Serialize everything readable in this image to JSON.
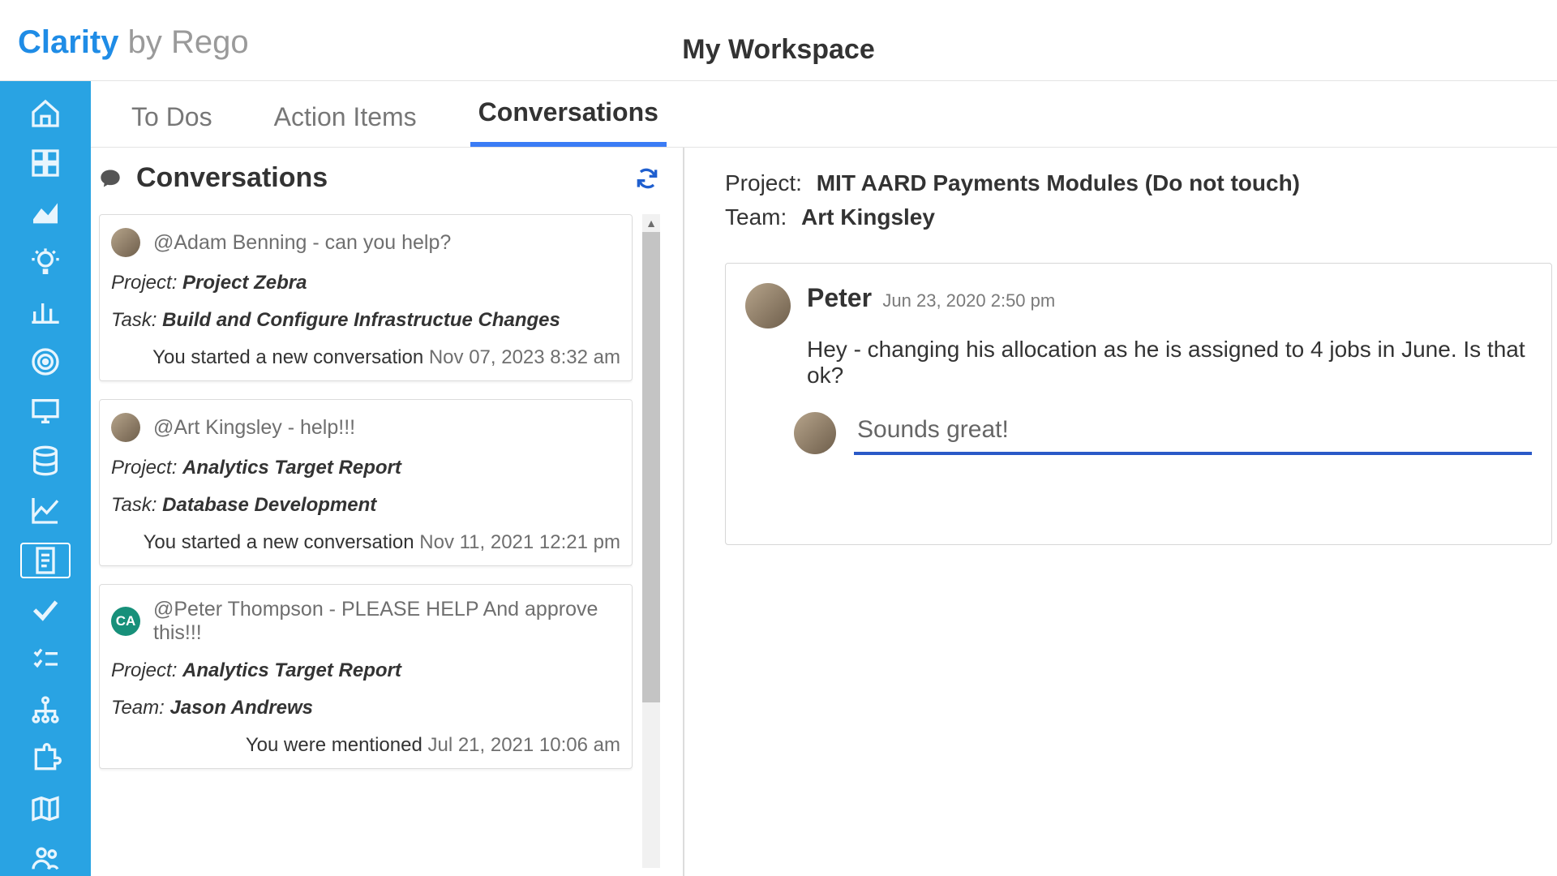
{
  "logo": {
    "brand": "Clarity",
    "suffix": " by Rego"
  },
  "page_title": "My Workspace",
  "tabs": [
    {
      "label": "To Dos",
      "active": false
    },
    {
      "label": "Action Items",
      "active": false
    },
    {
      "label": "Conversations",
      "active": true
    }
  ],
  "left_panel": {
    "title": "Conversations",
    "cards": [
      {
        "avatar_type": "photo",
        "mention": "@Adam Benning - can you help?",
        "project_label": "Project:",
        "project_value": "Project Zebra",
        "secondary_label": "Task:",
        "secondary_value": "Build and Configure Infrastructue Changes",
        "footer_text": "You started a new conversation",
        "footer_ts": "Nov 07, 2023 8:32 am"
      },
      {
        "avatar_type": "photo",
        "mention": "@Art Kingsley - help!!!",
        "project_label": "Project:",
        "project_value": "Analytics Target Report",
        "secondary_label": "Task:",
        "secondary_value": "Database Development",
        "footer_text": "You started a new conversation",
        "footer_ts": "Nov 11, 2021 12:21 pm"
      },
      {
        "avatar_type": "initials",
        "avatar_initials": "CA",
        "mention": "@Peter Thompson - PLEASE HELP And approve this!!!",
        "project_label": "Project:",
        "project_value": "Analytics Target Report",
        "secondary_label": "Team:",
        "secondary_value": "Jason Andrews",
        "footer_text": "You were mentioned",
        "footer_ts": "Jul 21, 2021 10:06 am"
      }
    ]
  },
  "right_panel": {
    "project_label": "Project:",
    "project_value": "MIT AARD Payments Modules (Do not touch)",
    "team_label": "Team:",
    "team_value": "Art Kingsley",
    "message": {
      "author": "Peter",
      "timestamp": "Jun 23, 2020 2:50 pm",
      "body": "Hey - changing his allocation as he is assigned to 4 jobs in June. Is that ok?"
    },
    "reply_value": "Sounds great! "
  },
  "sidebar_icons": [
    "home-icon",
    "grid-icon",
    "area-chart-icon",
    "idea-icon",
    "bar-chart-icon",
    "target-icon",
    "monitor-icon",
    "database-icon",
    "line-chart-icon",
    "clipboard-icon",
    "check-icon",
    "checklist-icon",
    "hierarchy-icon",
    "puzzle-icon",
    "map-icon",
    "people-icon"
  ]
}
